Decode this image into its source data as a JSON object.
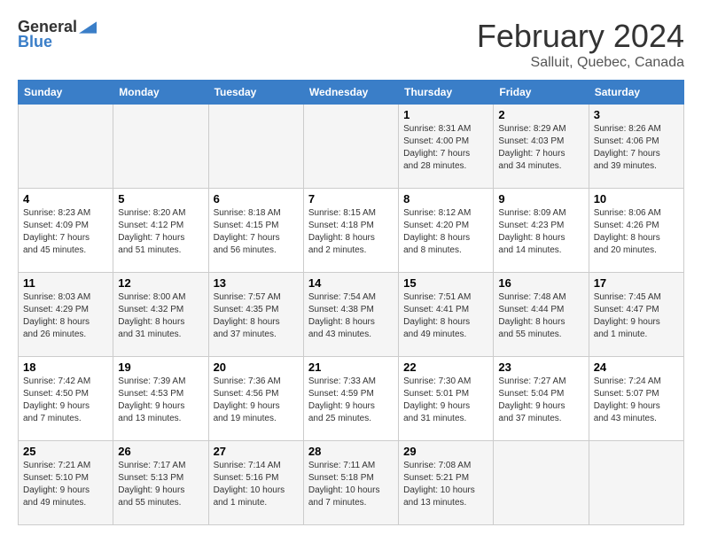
{
  "header": {
    "logo_general": "General",
    "logo_blue": "Blue",
    "month": "February 2024",
    "location": "Salluit, Quebec, Canada"
  },
  "days_of_week": [
    "Sunday",
    "Monday",
    "Tuesday",
    "Wednesday",
    "Thursday",
    "Friday",
    "Saturday"
  ],
  "weeks": [
    [
      {
        "day": "",
        "info": ""
      },
      {
        "day": "",
        "info": ""
      },
      {
        "day": "",
        "info": ""
      },
      {
        "day": "",
        "info": ""
      },
      {
        "day": "1",
        "info": "Sunrise: 8:31 AM\nSunset: 4:00 PM\nDaylight: 7 hours\nand 28 minutes."
      },
      {
        "day": "2",
        "info": "Sunrise: 8:29 AM\nSunset: 4:03 PM\nDaylight: 7 hours\nand 34 minutes."
      },
      {
        "day": "3",
        "info": "Sunrise: 8:26 AM\nSunset: 4:06 PM\nDaylight: 7 hours\nand 39 minutes."
      }
    ],
    [
      {
        "day": "4",
        "info": "Sunrise: 8:23 AM\nSunset: 4:09 PM\nDaylight: 7 hours\nand 45 minutes."
      },
      {
        "day": "5",
        "info": "Sunrise: 8:20 AM\nSunset: 4:12 PM\nDaylight: 7 hours\nand 51 minutes."
      },
      {
        "day": "6",
        "info": "Sunrise: 8:18 AM\nSunset: 4:15 PM\nDaylight: 7 hours\nand 56 minutes."
      },
      {
        "day": "7",
        "info": "Sunrise: 8:15 AM\nSunset: 4:18 PM\nDaylight: 8 hours\nand 2 minutes."
      },
      {
        "day": "8",
        "info": "Sunrise: 8:12 AM\nSunset: 4:20 PM\nDaylight: 8 hours\nand 8 minutes."
      },
      {
        "day": "9",
        "info": "Sunrise: 8:09 AM\nSunset: 4:23 PM\nDaylight: 8 hours\nand 14 minutes."
      },
      {
        "day": "10",
        "info": "Sunrise: 8:06 AM\nSunset: 4:26 PM\nDaylight: 8 hours\nand 20 minutes."
      }
    ],
    [
      {
        "day": "11",
        "info": "Sunrise: 8:03 AM\nSunset: 4:29 PM\nDaylight: 8 hours\nand 26 minutes."
      },
      {
        "day": "12",
        "info": "Sunrise: 8:00 AM\nSunset: 4:32 PM\nDaylight: 8 hours\nand 31 minutes."
      },
      {
        "day": "13",
        "info": "Sunrise: 7:57 AM\nSunset: 4:35 PM\nDaylight: 8 hours\nand 37 minutes."
      },
      {
        "day": "14",
        "info": "Sunrise: 7:54 AM\nSunset: 4:38 PM\nDaylight: 8 hours\nand 43 minutes."
      },
      {
        "day": "15",
        "info": "Sunrise: 7:51 AM\nSunset: 4:41 PM\nDaylight: 8 hours\nand 49 minutes."
      },
      {
        "day": "16",
        "info": "Sunrise: 7:48 AM\nSunset: 4:44 PM\nDaylight: 8 hours\nand 55 minutes."
      },
      {
        "day": "17",
        "info": "Sunrise: 7:45 AM\nSunset: 4:47 PM\nDaylight: 9 hours\nand 1 minute."
      }
    ],
    [
      {
        "day": "18",
        "info": "Sunrise: 7:42 AM\nSunset: 4:50 PM\nDaylight: 9 hours\nand 7 minutes."
      },
      {
        "day": "19",
        "info": "Sunrise: 7:39 AM\nSunset: 4:53 PM\nDaylight: 9 hours\nand 13 minutes."
      },
      {
        "day": "20",
        "info": "Sunrise: 7:36 AM\nSunset: 4:56 PM\nDaylight: 9 hours\nand 19 minutes."
      },
      {
        "day": "21",
        "info": "Sunrise: 7:33 AM\nSunset: 4:59 PM\nDaylight: 9 hours\nand 25 minutes."
      },
      {
        "day": "22",
        "info": "Sunrise: 7:30 AM\nSunset: 5:01 PM\nDaylight: 9 hours\nand 31 minutes."
      },
      {
        "day": "23",
        "info": "Sunrise: 7:27 AM\nSunset: 5:04 PM\nDaylight: 9 hours\nand 37 minutes."
      },
      {
        "day": "24",
        "info": "Sunrise: 7:24 AM\nSunset: 5:07 PM\nDaylight: 9 hours\nand 43 minutes."
      }
    ],
    [
      {
        "day": "25",
        "info": "Sunrise: 7:21 AM\nSunset: 5:10 PM\nDaylight: 9 hours\nand 49 minutes."
      },
      {
        "day": "26",
        "info": "Sunrise: 7:17 AM\nSunset: 5:13 PM\nDaylight: 9 hours\nand 55 minutes."
      },
      {
        "day": "27",
        "info": "Sunrise: 7:14 AM\nSunset: 5:16 PM\nDaylight: 10 hours\nand 1 minute."
      },
      {
        "day": "28",
        "info": "Sunrise: 7:11 AM\nSunset: 5:18 PM\nDaylight: 10 hours\nand 7 minutes."
      },
      {
        "day": "29",
        "info": "Sunrise: 7:08 AM\nSunset: 5:21 PM\nDaylight: 10 hours\nand 13 minutes."
      },
      {
        "day": "",
        "info": ""
      },
      {
        "day": "",
        "info": ""
      }
    ]
  ]
}
